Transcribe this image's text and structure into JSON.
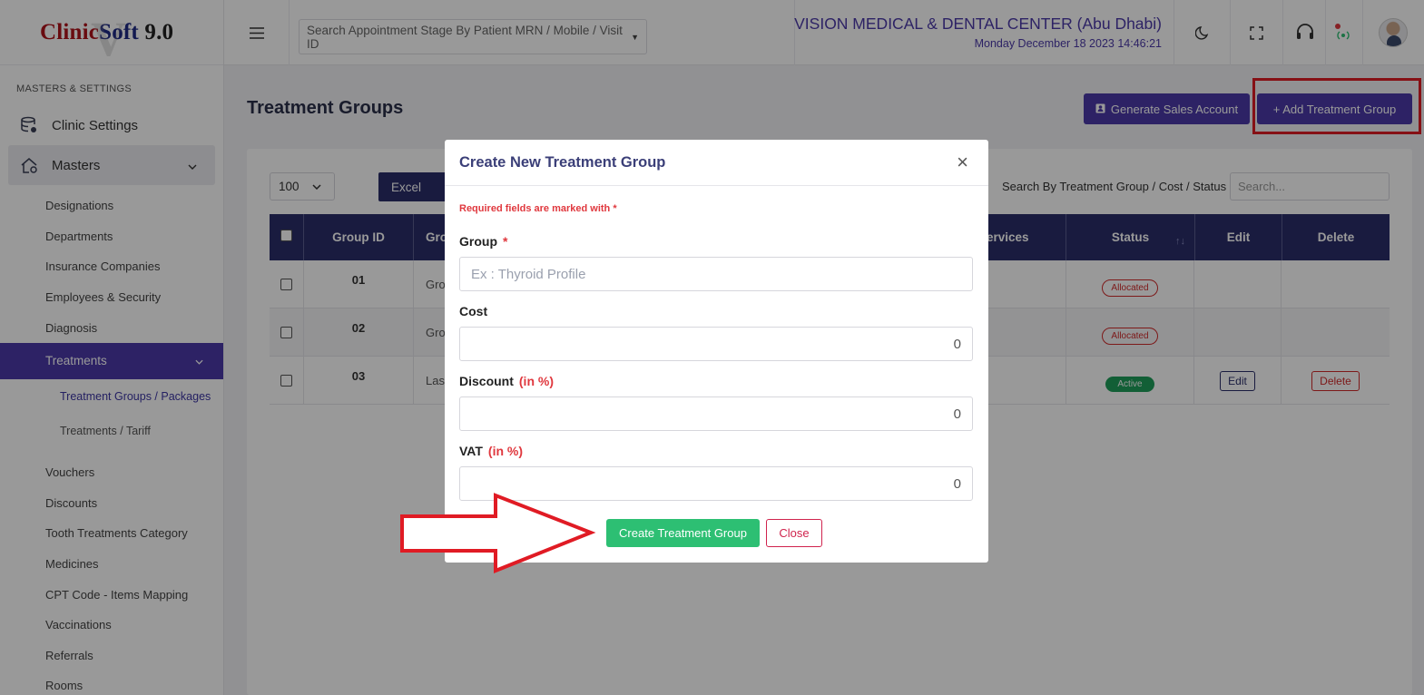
{
  "app": {
    "logo_part1": "Clinic",
    "logo_part2": "Soft",
    "logo_version": " 9.0",
    "watermark": "V"
  },
  "sidebar": {
    "section": "MASTERS & SETTINGS",
    "clinic_settings": "Clinic Settings",
    "masters": "Masters",
    "items": [
      "Designations",
      "Departments",
      "Insurance Companies",
      "Employees & Security",
      "Diagnosis"
    ],
    "treatments": "Treatments",
    "treatment_sub": [
      "Treatment Groups / Packages",
      "Treatments / Tariff"
    ],
    "items2": [
      "Vouchers",
      "Discounts",
      "Tooth Treatments Category",
      "Medicines",
      "CPT Code - Items Mapping",
      "Vaccinations",
      "Referrals",
      "Rooms"
    ]
  },
  "topbar": {
    "search_placeholder": "Search Appointment Stage By Patient MRN / Mobile / Visit ID",
    "clinic_name": "VISION MEDICAL & DENTAL CENTER (Abu Dhabi)",
    "datetime": "Monday December 18 2023 14:46:21",
    "icons": [
      "menu-icon",
      "moon-icon",
      "fullscreen-icon",
      "headset-icon",
      "broadcast-icon",
      "avatar"
    ]
  },
  "page": {
    "title": "Treatment Groups",
    "generate_btn": "Generate Sales Account",
    "add_btn": "+ Add Treatment Group",
    "page_size": "100",
    "excel": "Excel",
    "search_label": "Search By Treatment Group / Cost / Status",
    "search_placeholder": "Search..."
  },
  "table": {
    "headers": {
      "group_id": "Group ID",
      "group": "Gro",
      "services": "ervices",
      "status": "Status",
      "edit": "Edit",
      "delete": "Delete"
    },
    "rows": [
      {
        "id": "01",
        "group": "Gro",
        "status": "Allocated",
        "edit": "",
        "delete": ""
      },
      {
        "id": "02",
        "group": "Gro",
        "status": "Allocated",
        "edit": "",
        "delete": ""
      },
      {
        "id": "03",
        "group": "Las",
        "status": "Active",
        "edit": "Edit",
        "delete": "Delete"
      }
    ]
  },
  "modal": {
    "title": "Create New Treatment Group",
    "required_note": "Required fields are marked with *",
    "group_label": "Group",
    "group_star": "*",
    "group_placeholder": "Ex : Thyroid Profile",
    "cost_label": "Cost",
    "cost_value": "0",
    "discount_label": "Discount",
    "discount_unit": "(in %)",
    "discount_value": "0",
    "vat_label": "VAT",
    "vat_unit": "(in %)",
    "vat_value": "0",
    "create_btn": "Create Treatment Group",
    "close_btn": "Close"
  },
  "colors": {
    "primary": "#4b3aa8",
    "table_header": "#2a2e6a",
    "success": "#2dbf73",
    "danger": "#d0234d",
    "annotation_red": "#e01b24"
  }
}
